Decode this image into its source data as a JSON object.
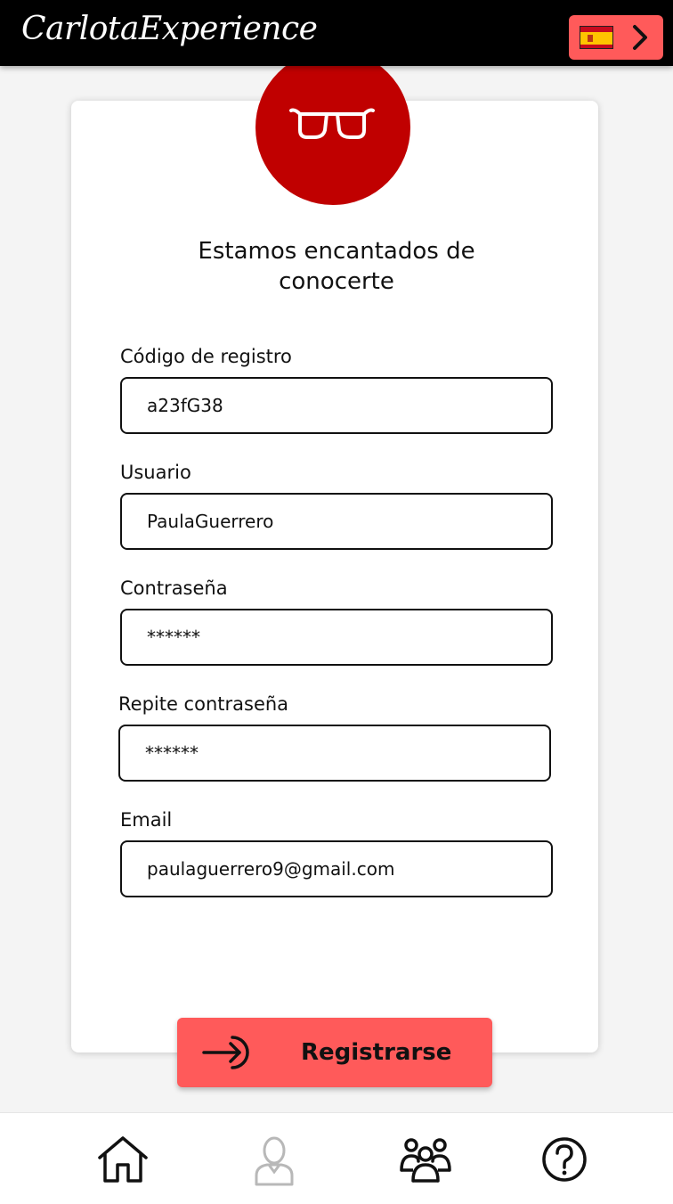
{
  "app": {
    "title": "CarlotaExperience"
  },
  "header": {
    "language_icon": "spain-flag-icon",
    "language_chevron_icon": "chevron-right-icon"
  },
  "form": {
    "avatar_icon": "glasses-icon",
    "heading": "Estamos encantados de conocerte",
    "fields": [
      {
        "label": "Código de registro",
        "value": "a23fG38"
      },
      {
        "label": "Usuario",
        "value": "PaulaGuerrero"
      },
      {
        "label": "Contraseña",
        "value": "******"
      },
      {
        "label": "Repite contraseña",
        "value": "******"
      },
      {
        "label": "Email",
        "value": "paulaguerrero9@gmail.com"
      }
    ],
    "submit_label": "Registrarse",
    "submit_icon": "login-arrow-icon"
  },
  "bottom_nav": [
    {
      "icon": "home-icon"
    },
    {
      "icon": "user-icon"
    },
    {
      "icon": "group-icon"
    },
    {
      "icon": "help-icon"
    }
  ],
  "colors": {
    "header_bg": "#000000",
    "accent": "#ff5a5a",
    "avatar_bg": "#c00000",
    "inactive_icon": "#b8b8b8"
  }
}
